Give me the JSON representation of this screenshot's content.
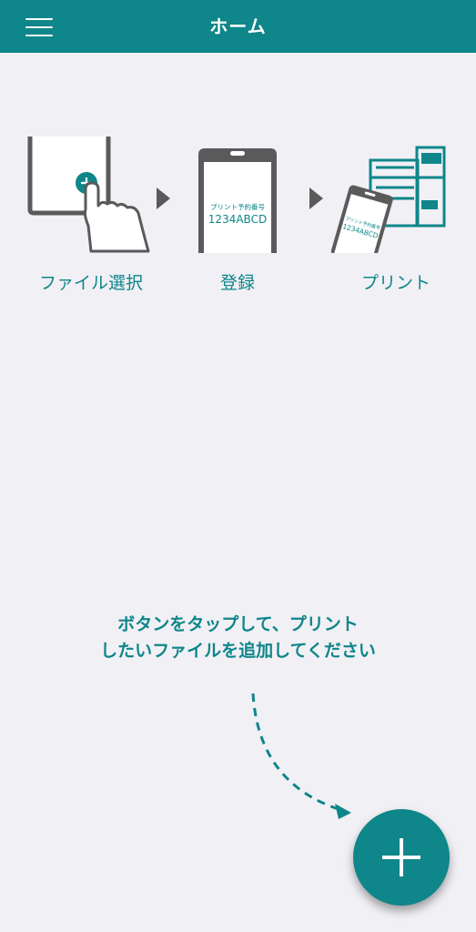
{
  "header": {
    "title": "ホーム",
    "menu_icon": "hamburger-menu-icon",
    "background_color": "#0e868a"
  },
  "steps": [
    {
      "label": "ファイル選択",
      "icon": "file-select-tap-icon"
    },
    {
      "label": "登録",
      "icon": "phone-register-icon"
    },
    {
      "label": "プリント",
      "icon": "printer-print-icon"
    }
  ],
  "phone_screen": {
    "caption": "プリント予約番号",
    "code": "1234ABCD"
  },
  "instruction": {
    "line1": "ボタンをタップして、プリント",
    "line2": "したいファイルを追加してください"
  },
  "fab": {
    "icon": "plus-icon",
    "color": "#0e868a"
  },
  "colors": {
    "accent": "#0e868a",
    "background": "#f1f0f5",
    "illustration_gray": "#5a5a5a"
  }
}
